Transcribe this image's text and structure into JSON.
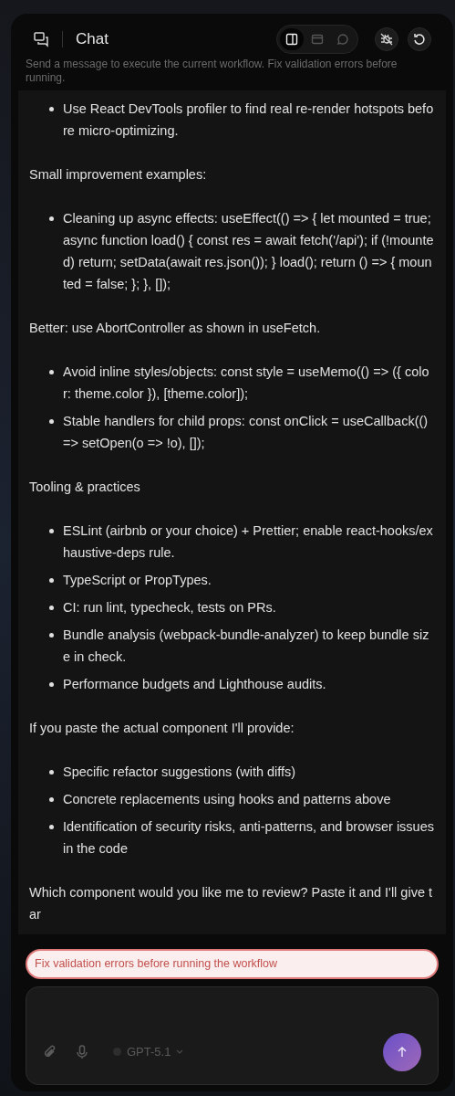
{
  "header": {
    "title": "Chat",
    "subtitle": "Send a message to execute the current workflow. Fix validation errors before running.",
    "view_modes": [
      {
        "kind": "panel",
        "selected": true
      },
      {
        "kind": "window",
        "selected": false
      },
      {
        "kind": "bubble",
        "selected": false
      }
    ]
  },
  "messages": [
    {
      "kind": "list",
      "items": [
        "Use React DevTools profiler to find real re-render hotspots before micro-optimizing."
      ]
    },
    {
      "kind": "paragraph",
      "text": "Small improvement examples:"
    },
    {
      "kind": "list",
      "items": [
        "Cleaning up async effects: useEffect(() => { let mounted = true; async function load() { const res = await fetch('/api'); if (!mounted) return; setData(await res.json()); } load(); return () => { mounted = false; }; }, []);"
      ]
    },
    {
      "kind": "paragraph",
      "text": "Better: use AbortController as shown in useFetch."
    },
    {
      "kind": "list",
      "items": [
        "Avoid inline styles/objects: const style = useMemo(() => ({ color: theme.color }), [theme.color]);",
        "Stable handlers for child props: const onClick = useCallback(() => setOpen(o => !o), []);"
      ]
    },
    {
      "kind": "paragraph",
      "text": "Tooling & practices"
    },
    {
      "kind": "list",
      "items": [
        "ESLint (airbnb or your choice) + Prettier; enable react-hooks/exhaustive-deps rule.",
        "TypeScript or PropTypes.",
        "CI: run lint, typecheck, tests on PRs.",
        "Bundle analysis (webpack-bundle-analyzer) to keep bundle size in check.",
        "Performance budgets and Lighthouse audits."
      ]
    },
    {
      "kind": "paragraph",
      "text": "If you paste the actual component I'll provide:"
    },
    {
      "kind": "list",
      "items": [
        "Specific refactor suggestions (with diffs)",
        "Concrete replacements using hooks and patterns above",
        "Identification of security risks, anti-patterns, and browser issues in the code"
      ]
    },
    {
      "kind": "paragraph",
      "text": "Which component would you like me to review? Paste it and I'll give tar"
    }
  ],
  "error": "Fix validation errors before running the workflow",
  "composer": {
    "model": "GPT-5.1"
  }
}
